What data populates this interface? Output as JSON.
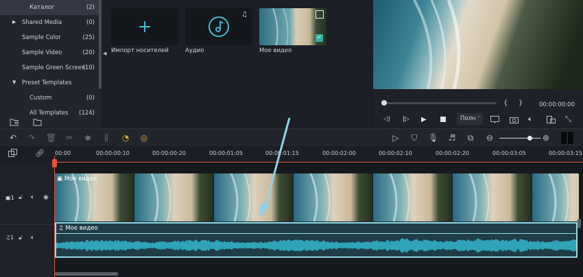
{
  "sidebar": {
    "items": [
      {
        "label": "Каталог",
        "count": "(2)",
        "active": true,
        "expandable": false
      },
      {
        "label": "Shared Media",
        "count": "(0)",
        "expandable": true
      },
      {
        "label": "Sample Color",
        "count": "(25)"
      },
      {
        "label": "Sample Video",
        "count": "(20)"
      },
      {
        "label": "Sample Green Screen",
        "count": "(10)"
      },
      {
        "label": "Preset Templates",
        "count": "",
        "expandable": true,
        "expanded": true
      },
      {
        "label": "Custom",
        "count": "(0)"
      },
      {
        "label": "All Templates",
        "count": "(124)"
      }
    ]
  },
  "media": {
    "items": [
      {
        "label": "Импорт носителей",
        "icon": "plus-icon"
      },
      {
        "label": "Аудио",
        "icon": "music-note-icon"
      },
      {
        "label": "Мое видео",
        "icon": "film-icon"
      }
    ]
  },
  "preview": {
    "timecode": "00:00:00:00",
    "brace_open": "{",
    "brace_close": "}",
    "quality": "Полн"
  },
  "timeline": {
    "ruler_labels": [
      "00:00",
      "00:00:00:10",
      "00:00:00:20",
      "00:00:01:05",
      "00:00:01:15",
      "00:00:02:00",
      "00:00:02:10",
      "00:00:02:20",
      "00:00:03:05",
      "00:00:03:15"
    ],
    "video_track": {
      "number": "1",
      "clip_label": "Мое видео"
    },
    "audio_track": {
      "number": "1",
      "clip_label": "Мое видео"
    }
  },
  "colors": {
    "accent": "#3fbfd0",
    "playhead": "#e8543a",
    "waveform": "#2f9fb3"
  }
}
